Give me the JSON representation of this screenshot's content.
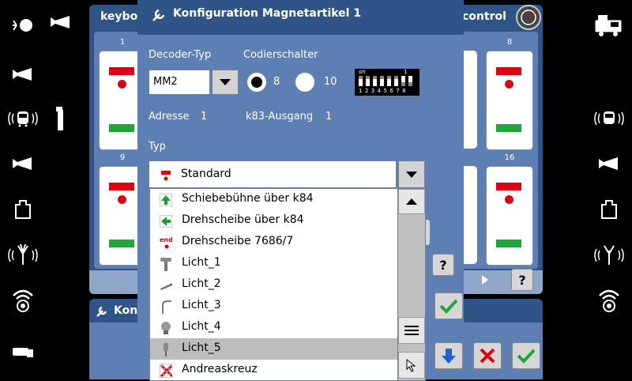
{
  "background_window": {
    "title_left": "keybo",
    "title_right": "control",
    "tile_numbers": [
      "1",
      "8",
      "9",
      "16"
    ]
  },
  "second_window": {
    "title": "Kon"
  },
  "dialog": {
    "title": "Konfiguration Magnetartikel 1",
    "decoder_type_label": "Decoder-Typ",
    "decoder_type_value": "MM2",
    "coding_switch_label": "Codierschalter",
    "radio_8_label": "8",
    "radio_10_label": "10",
    "dip_on_label": "on",
    "dip_one_label": "1",
    "dip_numbers": "1 2 3 4 5 6 7 8",
    "address_label": "Adresse",
    "address_value": "1",
    "k83_label": "k83-Ausgang",
    "k83_value": "1",
    "type_label": "Typ",
    "type_value": "Standard",
    "type_options": [
      {
        "label": "Schiebebühne über k84",
        "icon": "green-up-arrow-icon"
      },
      {
        "label": "Drehscheibe über k84",
        "icon": "green-left-arrow-icon"
      },
      {
        "label": "Drehscheibe 7686/7",
        "icon": "end-turntable-icon"
      },
      {
        "label": "Licht_1",
        "icon": "lamp-post-icon"
      },
      {
        "label": "Licht_2",
        "icon": "tube-light-icon"
      },
      {
        "label": "Licht_3",
        "icon": "curved-lamp-icon"
      },
      {
        "label": "Licht_4",
        "icon": "bulb-icon"
      },
      {
        "label": "Licht_5",
        "icon": "small-lamp-icon"
      },
      {
        "label": "Andreaskreuz",
        "icon": "crossbuck-icon"
      }
    ],
    "selected_option_index": 7
  },
  "colors": {
    "accent_dark": "#2e5488",
    "accent_light": "#5d7fb3",
    "signal_red": "#e00010",
    "signal_green": "#1fa83a"
  }
}
